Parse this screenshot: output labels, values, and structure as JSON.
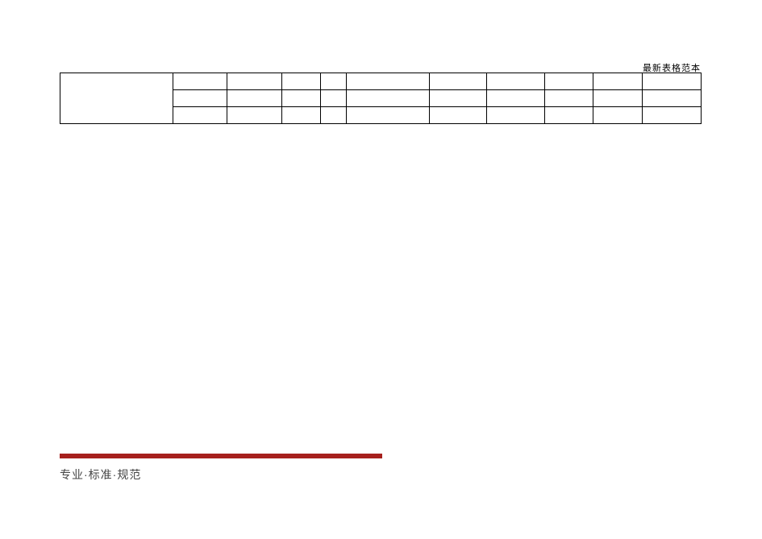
{
  "header": {
    "label": "最新表格范本"
  },
  "footer": {
    "motto": "专业·标准·规范"
  },
  "table": {
    "col_widths_pct": [
      17.6,
      8.5,
      8.5,
      6.0,
      4.0,
      13.0,
      9.0,
      9.0,
      7.6,
      7.6,
      9.2
    ]
  },
  "colors": {
    "accent_red": "#a6201d"
  }
}
